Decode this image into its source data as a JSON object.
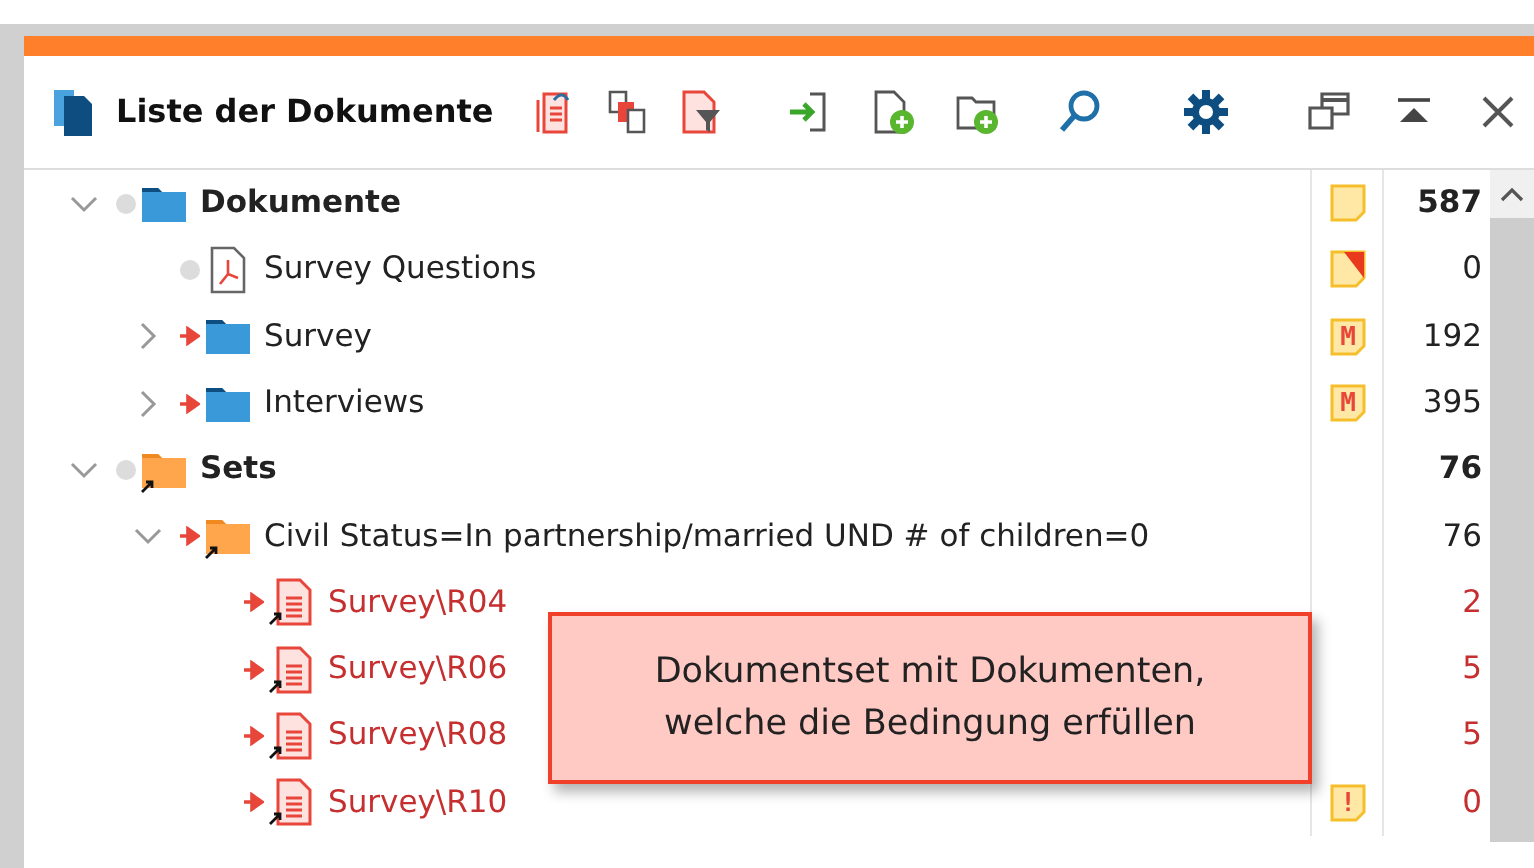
{
  "window": {
    "title": "Liste der Dokumente"
  },
  "tree": [
    {
      "label": "Dokumente",
      "kind": "folder",
      "bold": true,
      "expanded": true,
      "linked": false,
      "shortcut": false,
      "memo": {
        "kind": "plain"
      },
      "count": "587",
      "children": [
        {
          "label": "Survey Questions",
          "kind": "pdf",
          "bold": false,
          "linked": false,
          "shortcut": false,
          "memo": {
            "kind": "split"
          },
          "count": "0"
        },
        {
          "label": "Survey",
          "kind": "folder",
          "bold": false,
          "expanded": false,
          "linked": true,
          "shortcut": false,
          "memo": {
            "kind": "mark",
            "symbol": "M"
          },
          "count": "192"
        },
        {
          "label": "Interviews",
          "kind": "folder",
          "bold": false,
          "expanded": false,
          "linked": true,
          "shortcut": false,
          "memo": {
            "kind": "mark",
            "symbol": "M"
          },
          "count": "395"
        }
      ]
    },
    {
      "label": "Sets",
      "kind": "set",
      "bold": true,
      "expanded": true,
      "linked": false,
      "shortcut": true,
      "count": "76",
      "children": [
        {
          "label": "Civil Status=In partnership/married UND # of children=0",
          "kind": "set",
          "bold": false,
          "expanded": true,
          "linked": true,
          "shortcut": true,
          "count": "76",
          "children": [
            {
              "label": "Survey\\R04",
              "kind": "document",
              "bold": false,
              "linked": true,
              "shortcut": true,
              "count": "2"
            },
            {
              "label": "Survey\\R06",
              "kind": "document",
              "bold": false,
              "linked": true,
              "shortcut": true,
              "count": "5"
            },
            {
              "label": "Survey\\R08",
              "kind": "document",
              "bold": false,
              "linked": true,
              "shortcut": true,
              "count": "5"
            },
            {
              "label": "Survey\\R10",
              "kind": "document",
              "bold": false,
              "linked": true,
              "shortcut": true,
              "memo": {
                "kind": "mark",
                "symbol": "!"
              },
              "count": "0"
            }
          ]
        }
      ]
    }
  ],
  "callout": {
    "lines": [
      "Dokumentset mit Dokumenten,",
      "welche die Bedingung erfüllen"
    ]
  }
}
